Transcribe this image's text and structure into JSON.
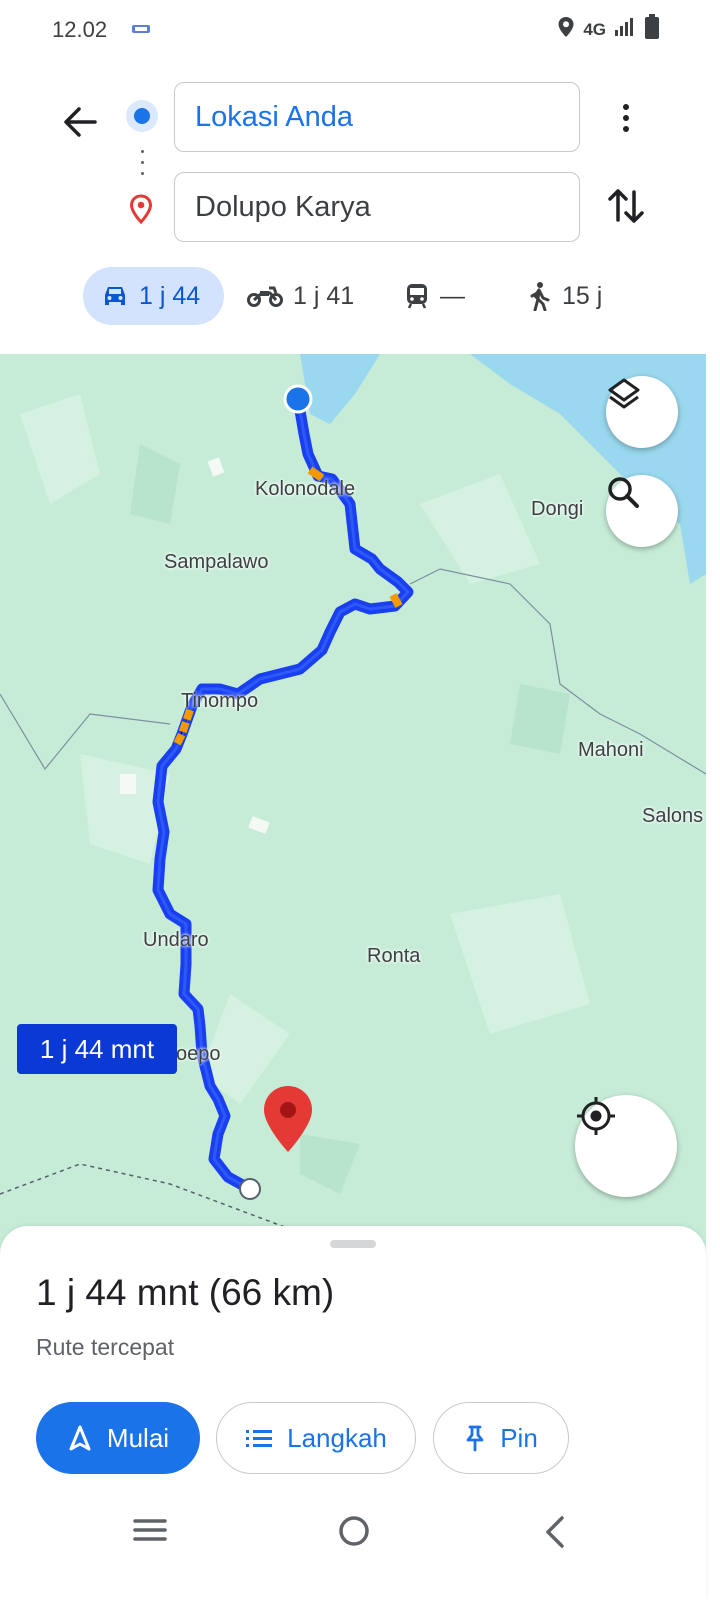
{
  "status": {
    "time": "12.02",
    "network": "4G",
    "icons": [
      "location-icon",
      "signal-icon",
      "battery-icon"
    ]
  },
  "directions": {
    "origin": "Lokasi Anda",
    "destination": "Dolupo Karya"
  },
  "modes": [
    {
      "icon": "car-icon",
      "label": "1 j 44",
      "selected": true
    },
    {
      "icon": "motorcycle-icon",
      "label": "1 j 41",
      "selected": false
    },
    {
      "icon": "transit-icon",
      "label": "—",
      "selected": false
    },
    {
      "icon": "walk-icon",
      "label": "15 j",
      "selected": false
    }
  ],
  "map": {
    "places": [
      "Kolonodale",
      "Dongi",
      "Sampalawo",
      "Tinompo",
      "Mahoni",
      "Salons",
      "Undaro",
      "Ronta",
      "oepo"
    ],
    "eta_chip": "1 j 44 mnt",
    "route_color": "#1a3ff0",
    "water_color": "#99d8ee",
    "land_color": "#c6ecd7"
  },
  "sheet": {
    "summary": "1 j 44 mnt (66 km)",
    "subtitle": "Rute tercepat",
    "start_label": "Mulai",
    "steps_label": "Langkah",
    "pin_label": "Pin"
  },
  "colors": {
    "accent": "#1a73e8",
    "active_mode_bg": "#d3e3fd",
    "destination_pin": "#e53935"
  }
}
